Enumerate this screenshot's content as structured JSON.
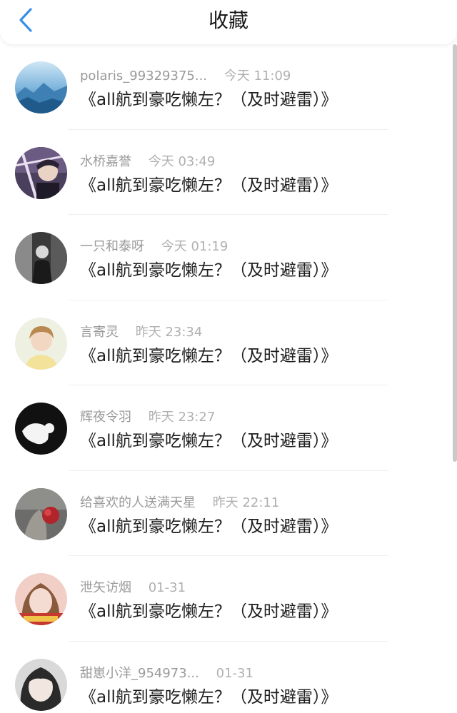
{
  "header": {
    "title": "收藏",
    "back_icon": "chevron-left-icon",
    "accent_color": "#3a8ee6"
  },
  "items": [
    {
      "name": "polaris_99329375...",
      "time": "今天 11:09",
      "title": "《all航到豪吃懒左？（及时避雷）》"
    },
    {
      "name": "水桥嘉誉",
      "time": "今天 03:49",
      "title": "《all航到豪吃懒左？（及时避雷）》"
    },
    {
      "name": "一只和泰呀",
      "time": "今天 01:19",
      "title": "《all航到豪吃懒左？（及时避雷）》"
    },
    {
      "name": "言寄灵",
      "time": "昨天 23:34",
      "title": "《all航到豪吃懒左？（及时避雷）》"
    },
    {
      "name": "辉夜令羽",
      "time": "昨天 23:27",
      "title": "《all航到豪吃懒左？（及时避雷）》"
    },
    {
      "name": "给喜欢的人送满天星",
      "time": "昨天 22:11",
      "title": "《all航到豪吃懒左？（及时避雷）》"
    },
    {
      "name": "泄矢访烟",
      "time": "01-31",
      "title": "《all航到豪吃懒左？（及时避雷）》"
    },
    {
      "name": "甜崽小洋_954973...",
      "time": "01-31",
      "title": "《all航到豪吃懒左？（及时避雷）》"
    }
  ]
}
